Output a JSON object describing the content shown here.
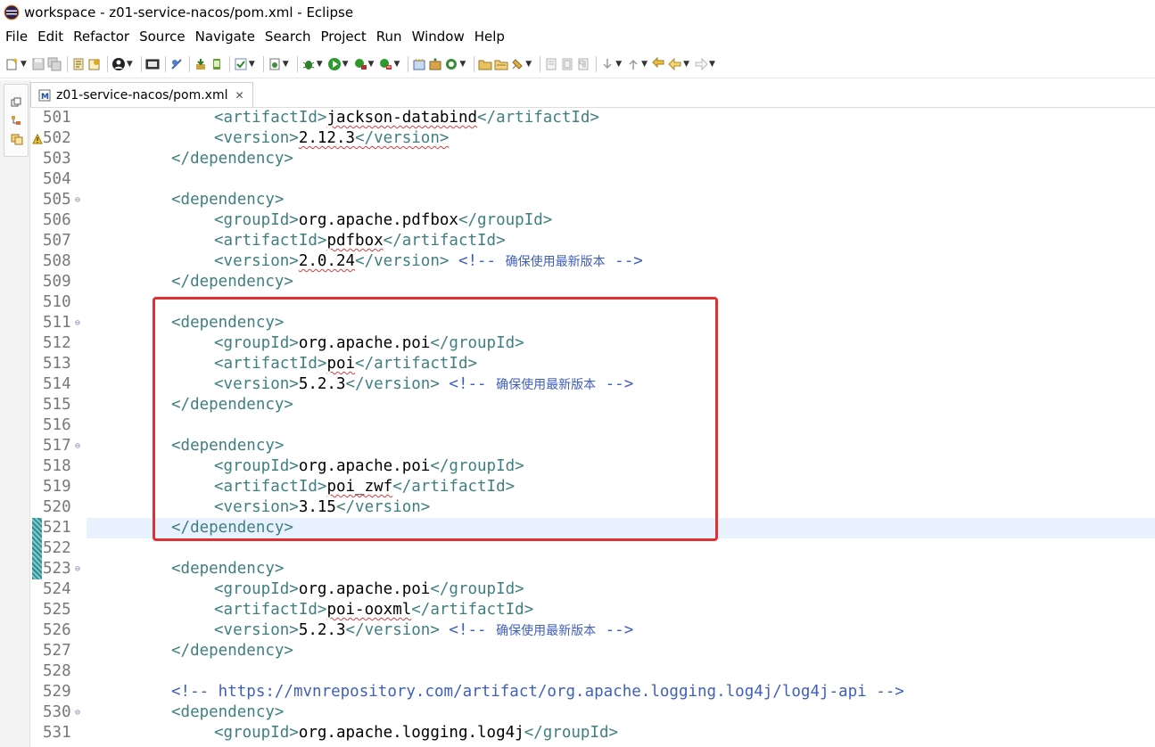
{
  "window": {
    "title": "workspace - z01-service-nacos/pom.xml - Eclipse"
  },
  "menu": [
    "File",
    "Edit",
    "Refactor",
    "Source",
    "Navigate",
    "Search",
    "Project",
    "Run",
    "Window",
    "Help"
  ],
  "editor_tab": {
    "label": "z01-service-nacos/pom.xml",
    "close": "✕"
  },
  "lines": [
    {
      "n": "501",
      "indent": 2,
      "parts": [
        [
          "tag",
          "<artifactId>"
        ],
        [
          "txt",
          "jackson-databind",
          "sq"
        ],
        [
          "tag",
          "</artifactId>"
        ]
      ]
    },
    {
      "n": "502",
      "indent": 2,
      "marker": "warn",
      "parts": [
        [
          "tag",
          "<version>"
        ],
        [
          "txt",
          "2.12.3",
          "sq"
        ],
        [
          "tag",
          "</version>",
          "sq"
        ]
      ]
    },
    {
      "n": "503",
      "indent": 1,
      "parts": [
        [
          "tag",
          "</dependency>"
        ]
      ]
    },
    {
      "n": "504",
      "indent": 0,
      "parts": []
    },
    {
      "n": "505",
      "indent": 1,
      "fold": true,
      "parts": [
        [
          "tag",
          "<dependency>"
        ]
      ]
    },
    {
      "n": "506",
      "indent": 2,
      "parts": [
        [
          "tag",
          "<groupId>"
        ],
        [
          "txt",
          "org.apache.pdfbox"
        ],
        [
          "tag",
          "</groupId>"
        ]
      ]
    },
    {
      "n": "507",
      "indent": 2,
      "parts": [
        [
          "tag",
          "<artifactId>"
        ],
        [
          "txt",
          "pdfbox",
          "sq"
        ],
        [
          "tag",
          "</artifactId>"
        ]
      ]
    },
    {
      "n": "508",
      "indent": 2,
      "parts": [
        [
          "tag",
          "<version>"
        ],
        [
          "txt",
          "2.0.24",
          "sq"
        ],
        [
          "tag",
          "</version>"
        ],
        [
          "txt",
          " "
        ],
        [
          "cmt",
          "<!-- "
        ],
        [
          "cjk",
          "确保使用最新版本"
        ],
        [
          "cmt",
          " -->"
        ]
      ]
    },
    {
      "n": "509",
      "indent": 1,
      "parts": [
        [
          "tag",
          "</dependency>"
        ]
      ]
    },
    {
      "n": "510",
      "indent": 0,
      "parts": []
    },
    {
      "n": "511",
      "indent": 1,
      "fold": true,
      "parts": [
        [
          "tag",
          "<dependency>"
        ]
      ]
    },
    {
      "n": "512",
      "indent": 2,
      "parts": [
        [
          "tag",
          "<groupId>"
        ],
        [
          "txt",
          "org.apache.poi"
        ],
        [
          "tag",
          "</groupId>"
        ]
      ]
    },
    {
      "n": "513",
      "indent": 2,
      "parts": [
        [
          "tag",
          "<artifactId>"
        ],
        [
          "txt",
          "poi",
          "sq"
        ],
        [
          "tag",
          "</artifactId>"
        ]
      ]
    },
    {
      "n": "514",
      "indent": 2,
      "parts": [
        [
          "tag",
          "<version>"
        ],
        [
          "txt",
          "5.2.3"
        ],
        [
          "tag",
          "</version>"
        ],
        [
          "txt",
          " "
        ],
        [
          "cmt",
          "<!-- "
        ],
        [
          "cjk",
          "确保使用最新版本"
        ],
        [
          "cmt",
          " -->"
        ]
      ]
    },
    {
      "n": "515",
      "indent": 1,
      "parts": [
        [
          "tag",
          "</dependency>"
        ]
      ]
    },
    {
      "n": "516",
      "indent": 0,
      "parts": []
    },
    {
      "n": "517",
      "indent": 1,
      "fold": true,
      "parts": [
        [
          "tag",
          "<dependency>"
        ]
      ]
    },
    {
      "n": "518",
      "indent": 2,
      "parts": [
        [
          "tag",
          "<groupId>"
        ],
        [
          "txt",
          "org.apache.poi"
        ],
        [
          "tag",
          "</groupId>"
        ]
      ]
    },
    {
      "n": "519",
      "indent": 2,
      "parts": [
        [
          "tag",
          "<artifactId>"
        ],
        [
          "txt",
          "poi_zwf",
          "sq"
        ],
        [
          "tag",
          "</artifactId>"
        ]
      ]
    },
    {
      "n": "520",
      "indent": 2,
      "parts": [
        [
          "tag",
          "<version>"
        ],
        [
          "txt",
          "3.15"
        ],
        [
          "tag",
          "</version>"
        ]
      ]
    },
    {
      "n": "521",
      "indent": 1,
      "current": true,
      "changed": true,
      "parts": [
        [
          "tag",
          "</dependency>"
        ]
      ]
    },
    {
      "n": "522",
      "indent": 0,
      "changed": true,
      "parts": []
    },
    {
      "n": "523",
      "indent": 1,
      "fold": true,
      "changed": true,
      "parts": [
        [
          "tag",
          "<dependency>"
        ]
      ]
    },
    {
      "n": "524",
      "indent": 2,
      "parts": [
        [
          "tag",
          "<groupId>"
        ],
        [
          "txt",
          "org.apache.poi"
        ],
        [
          "tag",
          "</groupId>"
        ]
      ]
    },
    {
      "n": "525",
      "indent": 2,
      "parts": [
        [
          "tag",
          "<artifactId>"
        ],
        [
          "txt",
          "poi-ooxml",
          "sq"
        ],
        [
          "tag",
          "</artifactId>"
        ]
      ]
    },
    {
      "n": "526",
      "indent": 2,
      "parts": [
        [
          "tag",
          "<version>"
        ],
        [
          "txt",
          "5.2.3"
        ],
        [
          "tag",
          "</version>"
        ],
        [
          "txt",
          " "
        ],
        [
          "cmt",
          "<!-- "
        ],
        [
          "cjk",
          "确保使用最新版本"
        ],
        [
          "cmt",
          " -->"
        ]
      ]
    },
    {
      "n": "527",
      "indent": 1,
      "parts": [
        [
          "tag",
          "</dependency>"
        ]
      ]
    },
    {
      "n": "528",
      "indent": 0,
      "parts": []
    },
    {
      "n": "529",
      "indent": 1,
      "parts": [
        [
          "cmt",
          "<!-- https://mvnrepository.com/artifact/org.apache.logging.log4j/log4j-api -->"
        ]
      ]
    },
    {
      "n": "530",
      "indent": 1,
      "fold": true,
      "parts": [
        [
          "tag",
          "<dependency>"
        ]
      ]
    },
    {
      "n": "531",
      "indent": 2,
      "parts": [
        [
          "tag",
          "<groupId>"
        ],
        [
          "txt",
          "org.apache.logging.log4j"
        ],
        [
          "tag",
          "</groupId>"
        ]
      ]
    }
  ],
  "colors": {
    "tag": "#3f7f7f",
    "comment": "#3f5fbf",
    "text": "#000000",
    "highlight_box": "#e03030",
    "current_line": "#e8f2fe"
  }
}
